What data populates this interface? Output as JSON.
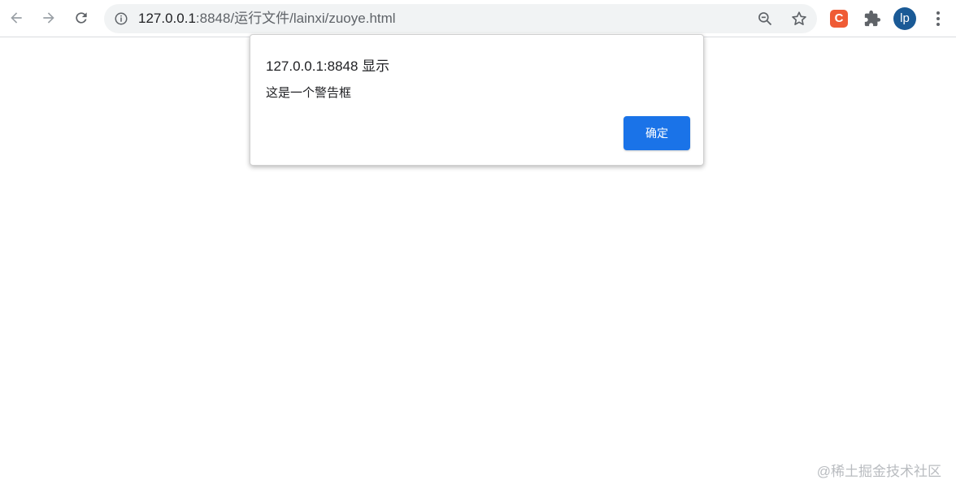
{
  "browser": {
    "url_host": "127.0.0.1",
    "url_rest": ":8848/运行文件/lainxi/zuoye.html",
    "profile_initials": "lp",
    "extension_letter": "C",
    "icons": {
      "back": "arrow-left-icon",
      "forward": "arrow-right-icon",
      "reload": "reload-icon",
      "site_info": "info-icon",
      "zoom": "zoom-out-icon",
      "bookmark": "star-icon",
      "extensions": "puzzle-icon",
      "menu": "more-vert-icon"
    }
  },
  "dialog": {
    "title": "127.0.0.1:8848 显示",
    "message": "这是一个警告框",
    "ok_label": "确定"
  },
  "watermark": "@稀土掘金技术社区",
  "colors": {
    "accent": "#1a73e8",
    "extension": "#ef5b35",
    "avatar": "#1a5a96"
  }
}
